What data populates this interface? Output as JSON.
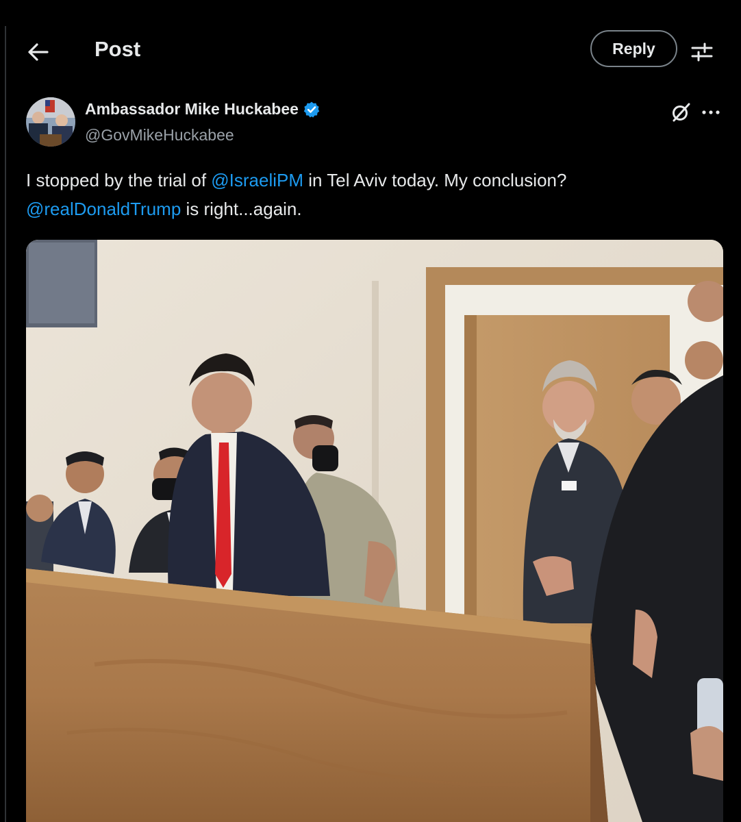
{
  "header": {
    "title": "Post",
    "reply_label": "Reply"
  },
  "post": {
    "author": {
      "display_name": "Ambassador Mike Huckabee",
      "handle": "@GovMikeHuckabee",
      "verified": true
    },
    "text": {
      "segment_1": "I stopped by the trial of ",
      "mention_1": "@IsraeliPM",
      "segment_2": " in Tel Aviv today.  My conclusion?",
      "mention_2": "@realDonaldTrump",
      "segment_3": " is right...again."
    },
    "media": {
      "type": "photo"
    }
  },
  "icons": {
    "back": "arrow-left-icon",
    "settings": "sliders-icon",
    "verified": "verified-badge-icon",
    "grok": "grok-icon",
    "more": "more-horizontal-icon"
  },
  "colors": {
    "background": "#000000",
    "text": "#e7e9ea",
    "secondary_text": "#9aa1a8",
    "link": "#1d9bf0",
    "verified_badge": "#1d9bf0"
  }
}
